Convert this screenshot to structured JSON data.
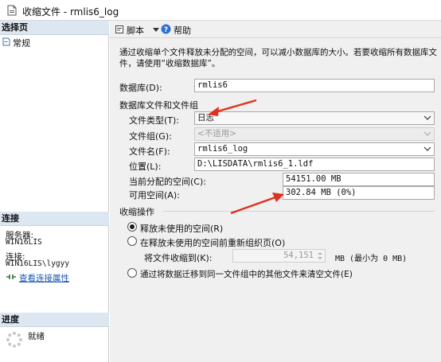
{
  "window": {
    "title": "收缩文件 - rmlis6_log"
  },
  "left_panel": {
    "select_page_header": "选择页",
    "pages": [
      {
        "label": "常规"
      }
    ],
    "connection_header": "连接",
    "server_label": "服务器:",
    "server_value": "WIN16LIS",
    "connection_label": "连接:",
    "connection_value": "WIN16LIS\\lygyy",
    "view_connection_link": "查看连接属性",
    "progress_header": "进度",
    "progress_status": "就绪"
  },
  "toolbar": {
    "script_label": "脚本",
    "help_label": "帮助"
  },
  "description": {
    "line1": "通过收缩单个文件释放未分配的空间，可以减小数据库的大小。若要收缩所有数据库文",
    "line2": "件，请使用“收缩数据库”。"
  },
  "form": {
    "database_label": "数据库(D):",
    "database_value": "rmlis6",
    "files_group_label": "数据库文件和文件组",
    "file_type_label": "文件类型(T):",
    "file_type_value": "日志",
    "filegroup_label": "文件组(G):",
    "filegroup_value": "<不适用>",
    "filename_label": "文件名(F):",
    "filename_value": "rmlis6_log",
    "location_label": "位置(L):",
    "location_value": "D:\\LISDATA\\rmlis6_1.ldf",
    "allocated_label": "当前分配的空间(C):",
    "allocated_value": "54151.00 MB",
    "available_label": "可用空间(A):",
    "available_value": "302.84 MB (0%)"
  },
  "shrink": {
    "header": "收缩操作",
    "option1_label": "释放未使用的空间(R)",
    "option2_label": "在释放未使用的空间前重新组织页(O)",
    "shrink_to_label": "将文件收缩到(K):",
    "shrink_to_value": "54,151",
    "shrink_to_unit": "MB (最小为 0 MB)",
    "option3_label": "通过将数据迁移到同一文件组中的其他文件来清空文件(E)",
    "selected_option": 1
  },
  "colors": {
    "accent_arrow": "#e0301e",
    "section_header_bg": "#dde7f1",
    "link": "#1a56b8"
  }
}
